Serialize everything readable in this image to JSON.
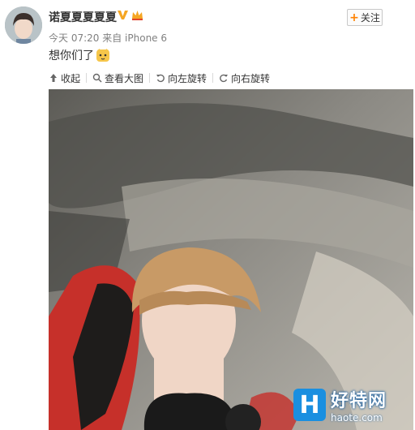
{
  "post": {
    "username": "诺夏夏夏夏夏",
    "verified_icon": "verified-v-icon",
    "member_icon": "crown-icon",
    "follow_label": "关注",
    "timestamp": "今天 07:20",
    "source": "来自 iPhone 6",
    "text": "想你们了",
    "emoji_icon": "cute-cat-emoji-icon"
  },
  "toolbar": {
    "collapse": "收起",
    "view_large": "查看大图",
    "rotate_left": "向左旋转",
    "rotate_right": "向右旋转"
  },
  "watermark": {
    "logo_letter": "H",
    "name": "好特网",
    "url": "haote.com"
  },
  "colors": {
    "accent": "#ff8200",
    "meta_text": "#808080",
    "watermark_blue": "#1a8fe0"
  }
}
